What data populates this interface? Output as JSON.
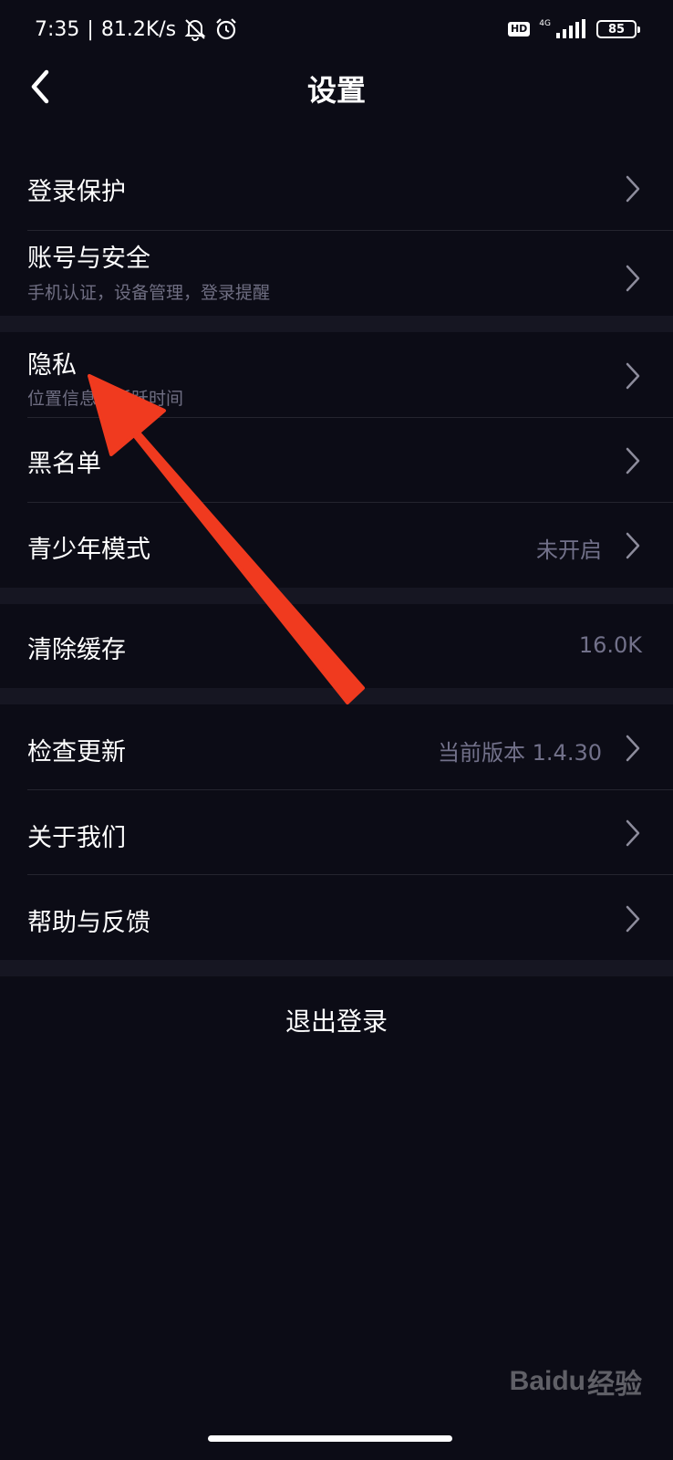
{
  "status_bar": {
    "time": "7:35",
    "speed": "81.2K/s",
    "hd": "HD",
    "network": "4G",
    "battery": "85"
  },
  "header": {
    "title": "设置"
  },
  "settings": {
    "login_protection": {
      "label": "登录保护"
    },
    "account_security": {
      "label": "账号与安全",
      "sub": "手机认证，设备管理，登录提醒"
    },
    "privacy": {
      "label": "隐私",
      "sub": "位置信息，活跃时间"
    },
    "blacklist": {
      "label": "黑名单"
    },
    "teen_mode": {
      "label": "青少年模式",
      "value": "未开启"
    },
    "clear_cache": {
      "label": "清除缓存",
      "value": "16.0K"
    },
    "check_update": {
      "label": "检查更新",
      "value": "当前版本 1.4.30"
    },
    "about_us": {
      "label": "关于我们"
    },
    "help_feedback": {
      "label": "帮助与反馈"
    }
  },
  "logout": {
    "label": "退出登录"
  },
  "watermark": {
    "brand": "Baidu",
    "sub": "经验"
  },
  "colors": {
    "background": "#0c0c16",
    "separator": "#161622",
    "secondary_text": "#72718a",
    "annotation": "#f03a1f"
  },
  "icons": {
    "back": "chevron-left-icon",
    "row_arrow": "chevron-right-icon",
    "mute": "bell-off-icon",
    "alarm": "alarm-clock-icon",
    "signal": "signal-bars-icon",
    "battery": "battery-icon"
  }
}
